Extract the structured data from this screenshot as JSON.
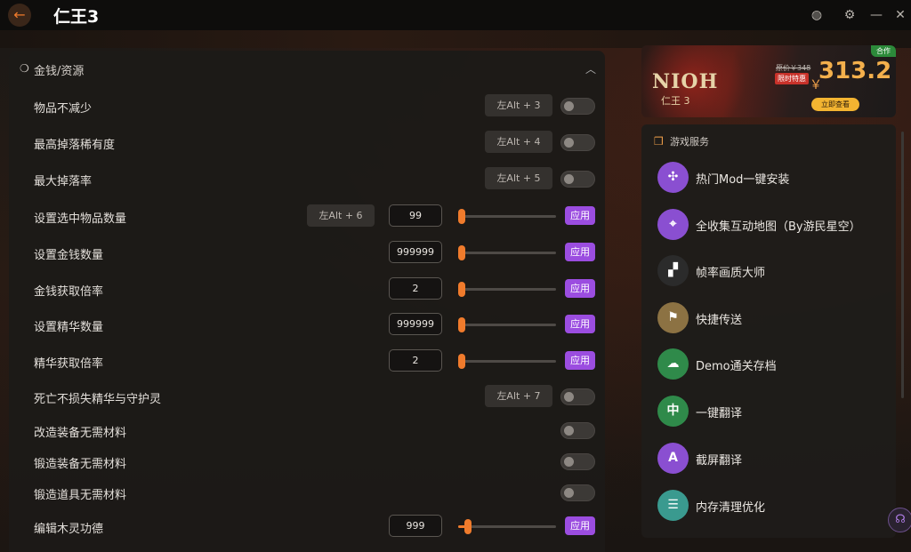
{
  "app": {
    "title": "仁王3",
    "back_icon": "←"
  },
  "titlebar_icons": {
    "avatar": "◍",
    "settings": "⚙",
    "minimize": "—",
    "close": "✕"
  },
  "section": {
    "title": "金钱/资源",
    "icon": "❍",
    "collapse_icon": "︿"
  },
  "rows": [
    {
      "label": "物品不减少",
      "hotkey": "左Alt + 3"
    },
    {
      "label": "最高掉落稀有度",
      "hotkey": "左Alt + 4"
    },
    {
      "label": "最大掉落率",
      "hotkey": "左Alt + 5"
    },
    {
      "label": "设置选中物品数量",
      "hotkey": "左Alt + 6",
      "value": "99",
      "apply": "应用",
      "slider": 0
    },
    {
      "label": "设置金钱数量",
      "value": "999999",
      "apply": "应用",
      "slider": 0
    },
    {
      "label": "金钱获取倍率",
      "value": "2",
      "apply": "应用",
      "slider": 0
    },
    {
      "label": "设置精华数量",
      "value": "999999",
      "apply": "应用",
      "slider": 0
    },
    {
      "label": "精华获取倍率",
      "value": "2",
      "apply": "应用",
      "slider": 0
    },
    {
      "label": "死亡不损失精华与守护灵",
      "hotkey": "左Alt + 7"
    },
    {
      "label": "改造装备无需材料"
    },
    {
      "label": "锻造装备无需材料"
    },
    {
      "label": "锻造道具无需材料"
    },
    {
      "label": "编辑木灵功德",
      "value": "999",
      "apply": "应用",
      "slider": 0.1
    }
  ],
  "ad": {
    "partner": "合作",
    "logo": "NIOH",
    "sublogo": "仁王 3",
    "original_price": "原价￥348",
    "sale_tag": "限时特惠",
    "currency": "￥",
    "price": "313.2",
    "cta": "立即查看"
  },
  "services": {
    "title": "游戏服务",
    "items": [
      {
        "label": "热门Mod一键安装",
        "icon": "mod-icon",
        "glyph": "✣",
        "color": "#8a4fd1"
      },
      {
        "label": "全收集互动地图（By游民星空）",
        "icon": "map-pin-icon",
        "glyph": "⌖",
        "color": "#8a4fd1"
      },
      {
        "label": "帧率画质大师",
        "icon": "fps-icon",
        "glyph": "▞",
        "color": "#2b2b2b"
      },
      {
        "label": "快捷传送",
        "icon": "teleport-map-icon",
        "glyph": "⚑",
        "color": "#8c7243"
      },
      {
        "label": "Demo通关存档",
        "icon": "save-cloud-icon",
        "glyph": "☁",
        "color": "#2f8a4a"
      },
      {
        "label": "一键翻译",
        "icon": "translate-icon",
        "glyph": "中",
        "color": "#2f8a4a"
      },
      {
        "label": "截屏翻译",
        "icon": "screenshot-translate-icon",
        "glyph": "A",
        "color": "#8a4fd1"
      },
      {
        "label": "内存清理优化",
        "icon": "memory-clean-icon",
        "glyph": "☰",
        "color": "#3a9a8f"
      }
    ]
  },
  "support_icon": "☊"
}
